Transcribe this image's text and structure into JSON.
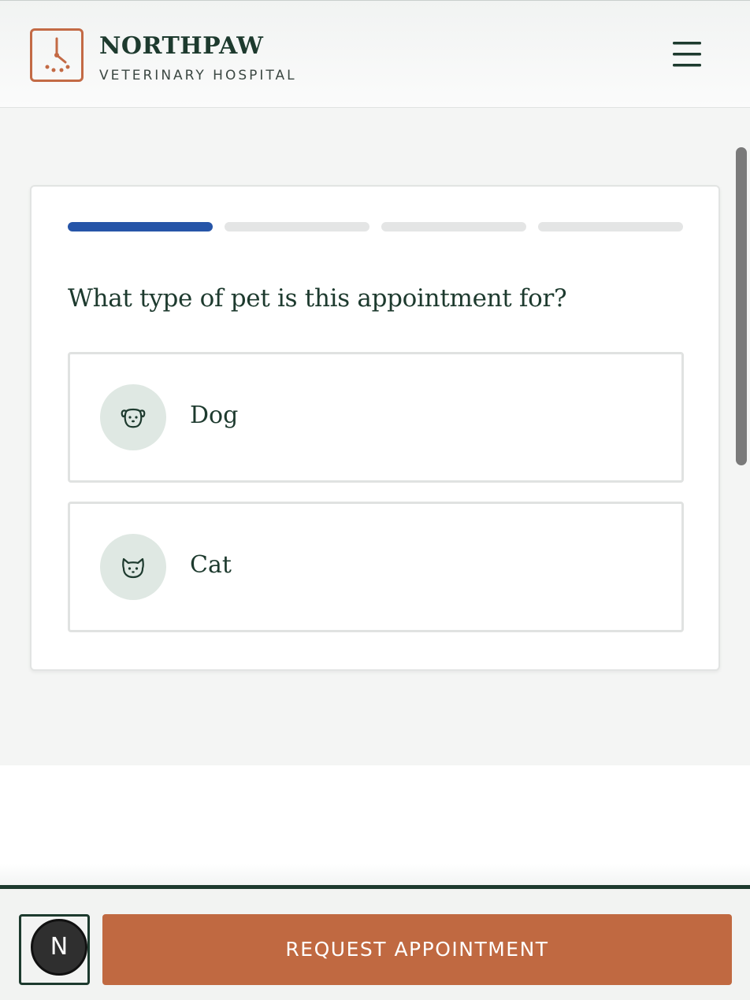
{
  "header": {
    "brand_name": "NORTHPAW",
    "brand_subtitle": "VETERINARY HOSPITAL",
    "logo_icon": "clock-paw-logo",
    "menu_icon": "hamburger-menu-icon"
  },
  "wizard": {
    "total_steps": 4,
    "current_step": 1,
    "question": "What type of pet is this appointment for?",
    "options": [
      {
        "label": "Dog",
        "icon": "dog-icon"
      },
      {
        "label": "Cat",
        "icon": "cat-icon"
      }
    ]
  },
  "footer": {
    "badge_letter": "N",
    "cta_label": "REQUEST APPOINTMENT"
  },
  "colors": {
    "brand_dark": "#1d3a2e",
    "accent_orange": "#c06941",
    "progress_active": "#2655a8",
    "progress_inactive": "#e4e5e5",
    "icon_circle": "#dfe8e3"
  }
}
